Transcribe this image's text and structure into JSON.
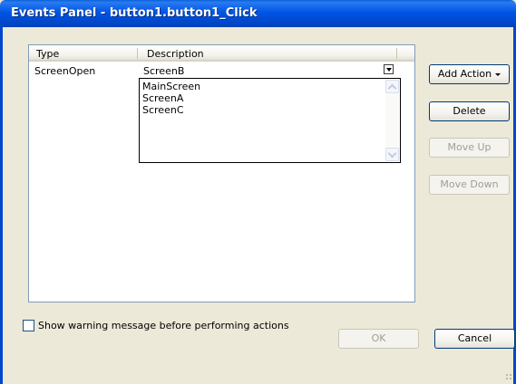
{
  "window": {
    "title": "Events Panel - button1.button1_Click"
  },
  "table": {
    "columns": [
      "Type",
      "Description"
    ],
    "rows": [
      {
        "type": "ScreenOpen",
        "description": "ScreenB"
      }
    ]
  },
  "dropdown": {
    "options": [
      "MainScreen",
      "ScreenA",
      "ScreenC"
    ]
  },
  "buttons": {
    "add_action": "Add Action",
    "delete": "Delete",
    "move_up": "Move Up",
    "move_down": "Move Down",
    "ok": "OK",
    "cancel": "Cancel"
  },
  "checkbox": {
    "label": "Show warning message before performing actions",
    "checked": false
  },
  "colors": {
    "titlebar": "#0055e5",
    "face": "#ece9d8",
    "border_accent": "#003c74"
  }
}
